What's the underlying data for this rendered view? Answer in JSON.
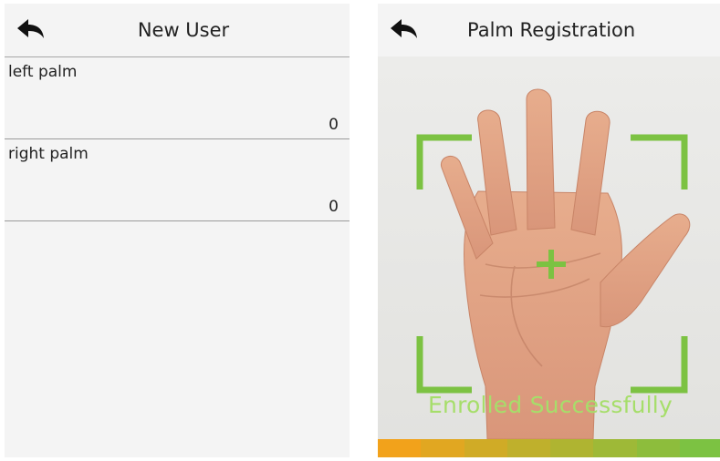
{
  "new_user": {
    "title": "New User",
    "fields": [
      {
        "label": "left palm",
        "value": "0"
      },
      {
        "label": "right palm",
        "value": "0"
      }
    ]
  },
  "palm_registration": {
    "title": "Palm Registration",
    "status": "Enrolled Successfully",
    "enrollment_progress": 1.0
  },
  "icons": {
    "back": "back-arrow-icon"
  },
  "colors": {
    "accent_green": "#7cc242",
    "status_text": "#a6de6a",
    "progress_start": "#f2a21b",
    "progress_end": "#7cc242"
  }
}
